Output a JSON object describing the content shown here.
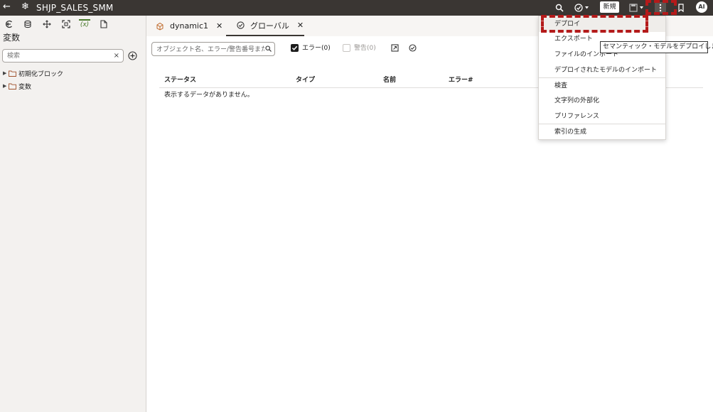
{
  "app": {
    "title": "SHJP_SALES_SMM"
  },
  "header": {
    "new_label": "新規",
    "avatar_initials": "AI"
  },
  "sidebar": {
    "title": "変数",
    "search_placeholder": "検索",
    "clear_glyph": "×",
    "tree": [
      {
        "label": "初期化ブロック"
      },
      {
        "label": "変数"
      }
    ]
  },
  "tabs": [
    {
      "label": "dynamic1",
      "close": "✕"
    },
    {
      "label": "グローバル",
      "close": "✕"
    }
  ],
  "filters": {
    "search_placeholder": "オブジェクト名、エラー/警告番号または",
    "errors_label": "エラー(0)",
    "errors_checked": true,
    "warnings_label": "警告(0)",
    "warnings_checked": false
  },
  "table": {
    "columns": [
      "ステータス",
      "タイプ",
      "名前",
      "エラー#"
    ],
    "empty_message": "表示するデータがありません。"
  },
  "menu": {
    "items": [
      {
        "label": "デプロイ"
      },
      {
        "label": "エクスポート"
      },
      {
        "label": "ファイルのインポート"
      },
      {
        "label": "デプロイされたモデルのインポート"
      },
      {
        "label": "検査"
      },
      {
        "label": "文字列の外部化"
      },
      {
        "label": "プリファレンス"
      },
      {
        "label": "索引の生成"
      }
    ]
  },
  "tooltip": {
    "text": "セマンティック・モデルをデプロイします"
  },
  "colors": {
    "topbar": "#3a3633",
    "highlight": "#b41a1a",
    "sidebar": "#f3f1ef"
  }
}
